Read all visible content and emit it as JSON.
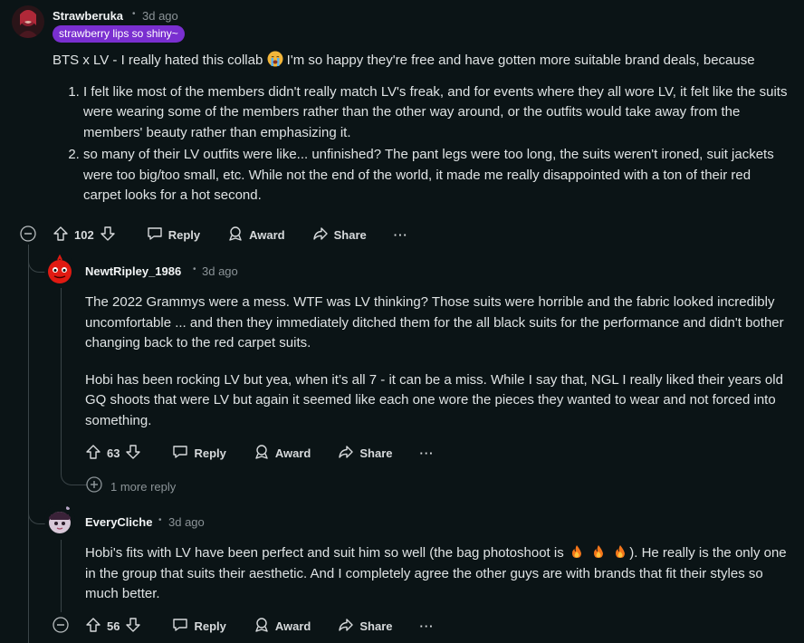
{
  "c1": {
    "user": "Strawberuka",
    "time": "3d ago",
    "flair": "strawberry lips so shiny~",
    "intro": "BTS x LV - I really hated this collab",
    "intro_rest": "I'm so happy they're free and have gotten more suitable brand deals, because",
    "list": [
      "I felt like most of the members didn't really match LV's freak, and for events where they all wore LV, it felt like the suits were wearing some of the members rather than the other way around, or the outfits would take away from the members' beauty rather than emphasizing it.",
      "so many of their LV outfits were like... unfinished? The pant legs were too long, the suits weren't ironed, suit jackets were too big/too small, etc. While not the end of the world, it made me really disappointed with a ton of their red carpet looks for a hot second."
    ],
    "votes": "102"
  },
  "c2": {
    "user": "NewtRipley_1986",
    "time": "3d ago",
    "p1": "The 2022 Grammys were a mess. WTF was LV thinking? Those suits were horrible and the fabric looked incredibly uncomfortable ... and then they immediately ditched them for the all black suits for the performance and didn't bother changing back to the red carpet suits.",
    "p2": "Hobi has been rocking LV but yea, when it’s all 7 - it can be a miss. While I say that, NGL I really liked their years old GQ shoots that were LV but again it seemed like each one wore the pieces they wanted to wear and not forced into something.",
    "votes": "63",
    "more": "1 more reply"
  },
  "c3": {
    "user": "EveryCliche",
    "time": "3d ago",
    "p1a": "Hobi's fits with LV have been perfect and suit him so well (the bag photoshoot is",
    "p1b": "). He really is the only one in the group that suits their aesthetic. And I completely agree the other guys are with brands that fit their styles so much better.",
    "votes": "56"
  },
  "labels": {
    "reply": "Reply",
    "award": "Award",
    "share": "Share",
    "dot": "•",
    "more": "···"
  },
  "icons": [
    "upvote-icon",
    "downvote-icon",
    "reply-icon",
    "award-icon",
    "share-icon",
    "collapse-icon",
    "expand-icon",
    "fire-emoji",
    "sob-emoji"
  ]
}
